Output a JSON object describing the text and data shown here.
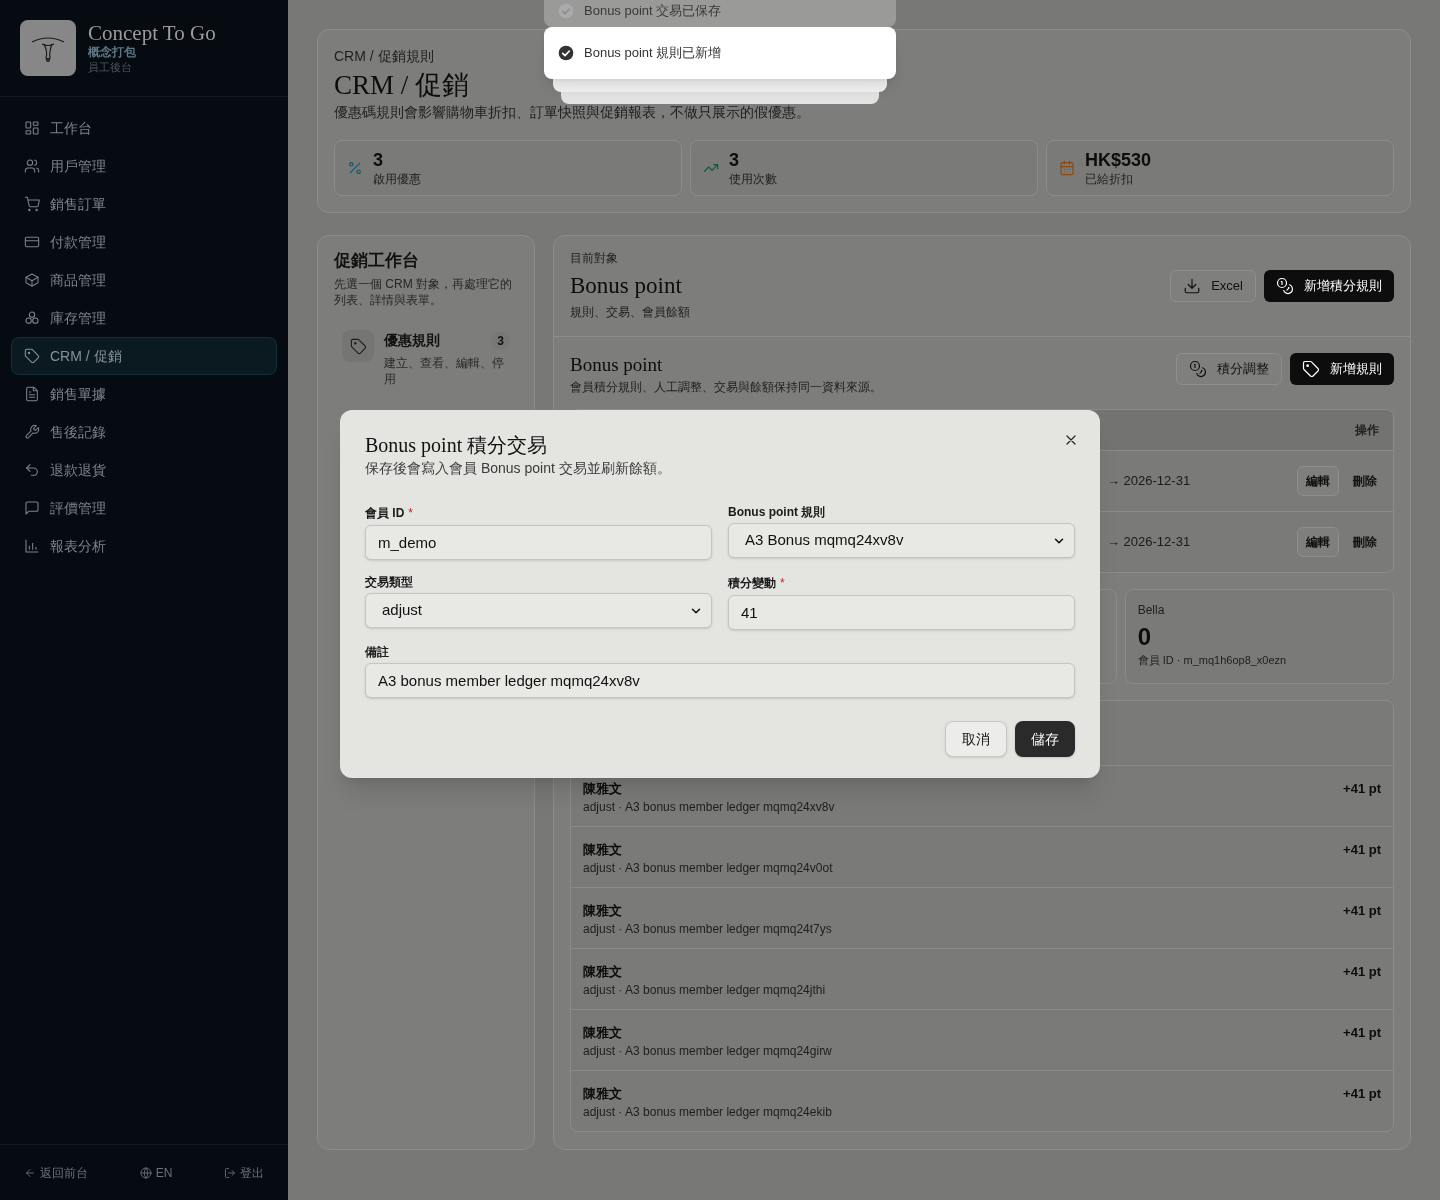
{
  "sidebar": {
    "brand": {
      "name": "Concept To Go",
      "subtitle": "概念打包",
      "caption": "員工後台"
    },
    "items": [
      {
        "label": "工作台",
        "selected": false
      },
      {
        "label": "用戶管理",
        "selected": false
      },
      {
        "label": "銷售訂單",
        "selected": false
      },
      {
        "label": "付款管理",
        "selected": false
      },
      {
        "label": "商品管理",
        "selected": false
      },
      {
        "label": "庫存管理",
        "selected": false
      },
      {
        "label": "CRM / 促銷",
        "selected": true
      },
      {
        "label": "銷售單據",
        "selected": false
      },
      {
        "label": "售後記錄",
        "selected": false
      },
      {
        "label": "退款退貨",
        "selected": false
      },
      {
        "label": "評價管理",
        "selected": false
      },
      {
        "label": "報表分析",
        "selected": false
      }
    ],
    "footer": [
      {
        "label": "返回前台"
      },
      {
        "label": "EN"
      },
      {
        "label": "登出"
      }
    ]
  },
  "toasts": [
    {
      "text": "Bonus point 交易已保存",
      "selected": false
    },
    {
      "text": "Bonus point 規則已新增",
      "selected": true
    }
  ],
  "header": {
    "breadcrumb": "CRM / 促銷規則",
    "title": "CRM / 促銷",
    "description": "優惠碼規則會影響購物車折扣、訂單快照與促銷報表，不做只展示的假優惠。",
    "stats": [
      {
        "value": "3",
        "label": "啟用優惠"
      },
      {
        "value": "3",
        "label": "使用次數"
      },
      {
        "value": "HK$530",
        "label": "已給折扣"
      }
    ]
  },
  "workspace": {
    "title": "促銷工作台",
    "description": "先選一個 CRM 對象，再處理它的列表、詳情與表單。",
    "items": [
      {
        "label": "優惠規則",
        "count": "3",
        "description": "建立、查看、編輯、停用",
        "selected": false
      }
    ]
  },
  "object_panel": {
    "eyebrow": "目前對象",
    "title": "Bonus point",
    "subtitle": "規則、交易、會員餘額",
    "actions": [
      {
        "label": "Excel",
        "kind": "outline"
      },
      {
        "label": "新增積分規則",
        "kind": "primary"
      }
    ]
  },
  "section": {
    "title": "Bonus point",
    "description": "會員積分規則、人工調整、交易與餘額保持同一資料來源。",
    "actions": [
      {
        "label": "積分調整",
        "kind": "outline"
      },
      {
        "label": "新增規則",
        "kind": "primary"
      }
    ]
  },
  "rules_table": {
    "columns": [
      "操作"
    ],
    "rows": [
      {
        "validity": "→ 2026-12-31",
        "actions": [
          "編輯",
          "刪除"
        ]
      },
      {
        "validity": "→ 2026-12-31",
        "actions": [
          "編輯",
          "刪除"
        ]
      }
    ]
  },
  "members": [
    {
      "name": "Bella",
      "balance": "0",
      "member_id": "會員 ID · m_mq1h6op8_x0ezn"
    }
  ],
  "transactions": [
    {
      "member": "陳雅文",
      "detail": "adjust · A3 bonus member ledger mqmq24xv8v",
      "points": "+41 pt"
    },
    {
      "member": "陳雅文",
      "detail": "adjust · A3 bonus member ledger mqmq24v0ot",
      "points": "+41 pt"
    },
    {
      "member": "陳雅文",
      "detail": "adjust · A3 bonus member ledger mqmq24t7ys",
      "points": "+41 pt"
    },
    {
      "member": "陳雅文",
      "detail": "adjust · A3 bonus member ledger mqmq24jthi",
      "points": "+41 pt"
    },
    {
      "member": "陳雅文",
      "detail": "adjust · A3 bonus member ledger mqmq24girw",
      "points": "+41 pt"
    },
    {
      "member": "陳雅文",
      "detail": "adjust · A3 bonus member ledger mqmq24ekib",
      "points": "+41 pt"
    }
  ],
  "dialog": {
    "title": "Bonus point 積分交易",
    "description": "保存後會寫入會員 Bonus point 交易並刷新餘額。",
    "fields": [
      {
        "label": "會員 ID",
        "required_mark": "*",
        "kind": "text",
        "value": "m_demo"
      },
      {
        "label": "Bonus point 規則",
        "kind": "select",
        "value": "A3 Bonus mqmq24xv8v"
      },
      {
        "label": "交易類型",
        "kind": "select",
        "value": "adjust"
      },
      {
        "label": "積分變動",
        "required_mark": "*",
        "kind": "text",
        "value": "41"
      },
      {
        "label": "備註",
        "kind": "note",
        "value": "A3 bonus member ledger mqmq24xv8v"
      }
    ],
    "buttons": [
      {
        "label": "取消",
        "kind": "outline"
      },
      {
        "label": "儲存",
        "kind": "primary"
      }
    ]
  }
}
